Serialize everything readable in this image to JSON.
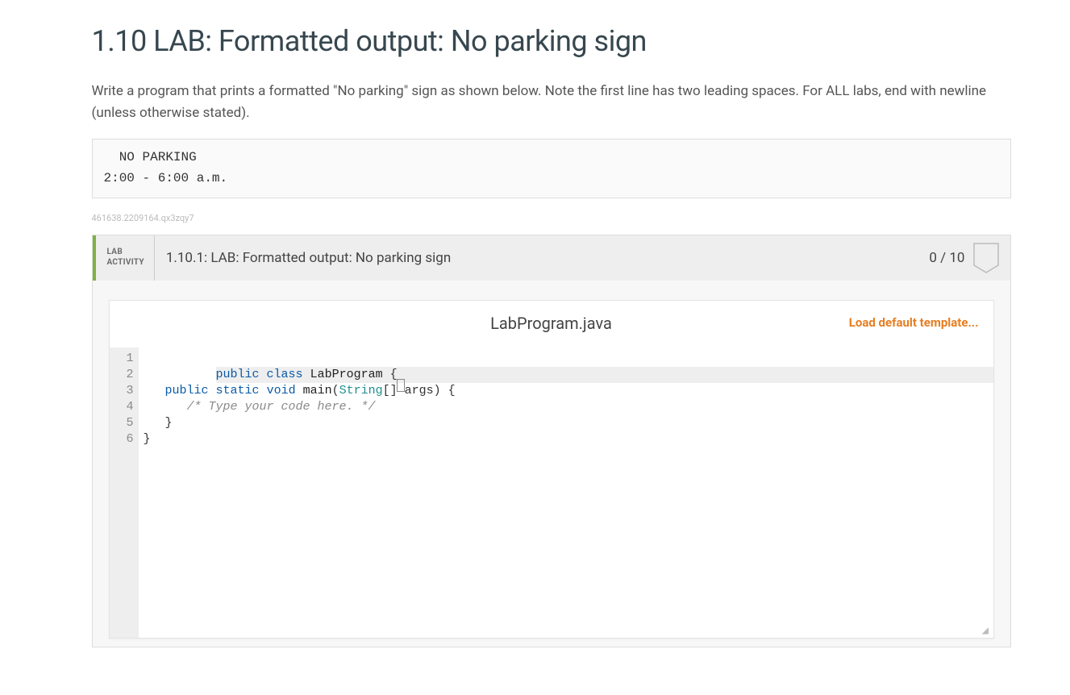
{
  "page": {
    "title": "1.10 LAB: Formatted output: No parking sign",
    "description": "Write a program that prints a formatted \"No parking\" sign as shown below. Note the first line has two leading spaces. For ALL labs, end with newline (unless otherwise stated).",
    "sample_output": "  NO PARKING\n2:00 - 6:00 a.m.",
    "hash": "461638.2209164.qx3zqy7"
  },
  "lab": {
    "badge_line1": "LAB",
    "badge_line2": "ACTIVITY",
    "activity_title": "1.10.1: LAB: Formatted output: No parking sign",
    "score": "0 / 10"
  },
  "editor": {
    "filename": "LabProgram.java",
    "load_template_label": "Load default template...",
    "line_numbers": [
      "1",
      "2",
      "3",
      "4",
      "5",
      "6"
    ],
    "code_lines": [
      {
        "highlighted": true,
        "tokens": [
          {
            "cls": "kw",
            "t": "public"
          },
          {
            "t": " "
          },
          {
            "cls": "kw",
            "t": "class"
          },
          {
            "t": " "
          },
          {
            "cls": "fn",
            "t": "LabProgram"
          },
          {
            "t": " {"
          },
          {
            "cursor": true
          }
        ]
      },
      {
        "tokens": [
          {
            "t": "   "
          },
          {
            "cls": "kw",
            "t": "public"
          },
          {
            "t": " "
          },
          {
            "cls": "kw",
            "t": "static"
          },
          {
            "t": " "
          },
          {
            "cls": "kw",
            "t": "void"
          },
          {
            "t": " "
          },
          {
            "cls": "fn",
            "t": "main"
          },
          {
            "t": "("
          },
          {
            "cls": "typ",
            "t": "String"
          },
          {
            "t": "[] args) {"
          }
        ]
      },
      {
        "tokens": [
          {
            "t": "      "
          },
          {
            "cls": "cm",
            "t": "/* Type your code here. */"
          }
        ]
      },
      {
        "tokens": [
          {
            "t": "   }"
          }
        ]
      },
      {
        "tokens": [
          {
            "t": "}"
          }
        ]
      },
      {
        "tokens": [
          {
            "t": ""
          }
        ]
      }
    ]
  }
}
